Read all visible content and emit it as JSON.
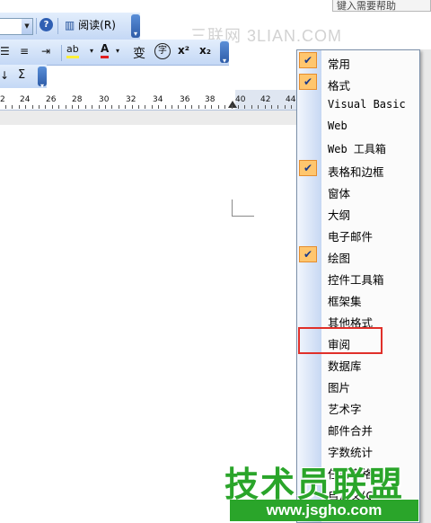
{
  "top_search": {
    "text": "键入需要帮助"
  },
  "watermark_top": "三联网 3LIAN.COM",
  "toolbar_standard": {
    "help_icon": "?",
    "read_label": "阅读(R)"
  },
  "toolbar_format": {
    "icons": [
      "align-icon",
      "line-spacing-icon",
      "indent-icon",
      "highlight-icon",
      "font-color-icon",
      "phonetic-guide-icon",
      "enclose-char-icon",
      "superscript-icon",
      "subscript-icon"
    ],
    "phonetic": "变",
    "enclose": "字",
    "font_color_glyph": "A",
    "superscript": "x²",
    "subscript": "x₂"
  },
  "toolbar_tables": {
    "sum_icon": "Σ"
  },
  "ruler": {
    "numbers": [
      "2",
      "24",
      "26",
      "28",
      "30",
      "32",
      "34",
      "36",
      "38",
      "40",
      "42",
      "44"
    ]
  },
  "menu": {
    "items": [
      {
        "label": "常用",
        "checked": true
      },
      {
        "label": "格式",
        "checked": true
      },
      {
        "label": "Visual Basic",
        "checked": false
      },
      {
        "label": "Web",
        "checked": false
      },
      {
        "label": "Web 工具箱",
        "checked": false
      },
      {
        "label": "表格和边框",
        "checked": true
      },
      {
        "label": "窗体",
        "checked": false
      },
      {
        "label": "大纲",
        "checked": false
      },
      {
        "label": "电子邮件",
        "checked": false
      },
      {
        "label": "绘图",
        "checked": true
      },
      {
        "label": "控件工具箱",
        "checked": false
      },
      {
        "label": "框架集",
        "checked": false
      },
      {
        "label": "其他格式",
        "checked": false
      },
      {
        "label": "审阅",
        "checked": false
      },
      {
        "label": "数据库",
        "checked": false
      },
      {
        "label": "图片",
        "checked": false
      },
      {
        "label": "艺术字",
        "checked": false
      },
      {
        "label": "邮件合并",
        "checked": false
      },
      {
        "label": "字数统计",
        "checked": false
      },
      {
        "label": "任务窗格",
        "checked": false
      },
      {
        "label": "自定义(C)...",
        "checked": false
      }
    ],
    "highlighted": "审阅"
  },
  "watermark_bottom": {
    "title": "技术员联盟",
    "url": "www.jsgho.com"
  },
  "colors": {
    "check_bg": "#ffc66e",
    "highlight": "#e0302a",
    "brand_green": "#2aa52a"
  }
}
